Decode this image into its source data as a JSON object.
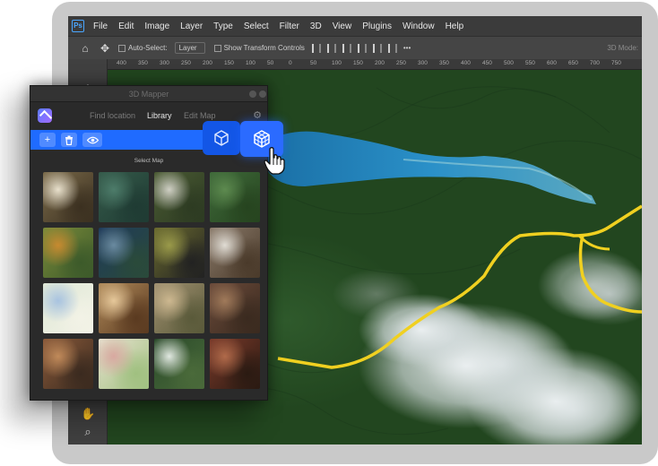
{
  "app": {
    "logo_text": "Ps",
    "menu": [
      "File",
      "Edit",
      "Image",
      "Layer",
      "Type",
      "Select",
      "Filter",
      "3D",
      "View",
      "Plugins",
      "Window",
      "Help"
    ]
  },
  "options_bar": {
    "auto_select_label": "Auto-Select:",
    "layer_select_value": "Layer",
    "show_transform_label": "Show Transform Controls",
    "mode_3d_label": "3D Mode:"
  },
  "ruler": {
    "ticks": [
      "400",
      "350",
      "300",
      "250",
      "200",
      "150",
      "100",
      "50",
      "0",
      "50",
      "100",
      "150",
      "200",
      "250",
      "300",
      "350",
      "400",
      "450",
      "500",
      "550",
      "600",
      "650",
      "700",
      "750"
    ]
  },
  "panel": {
    "title": "3D Mapper",
    "nav": [
      {
        "label": "Find location",
        "active": false
      },
      {
        "label": "Library",
        "active": true
      },
      {
        "label": "Edit Map",
        "active": false
      }
    ],
    "actions": [
      {
        "icon": "plus-icon",
        "glyph": "+"
      },
      {
        "icon": "trash-icon",
        "glyph": "🗑"
      },
      {
        "icon": "eye-icon",
        "glyph": "👁"
      }
    ],
    "select_map_label": "Select Map",
    "accent_color": "#1f6bff"
  },
  "thumbnails": [
    {
      "name": "map-thumb-mountain-relief",
      "colors": [
        "#7a6a4a",
        "#e8e0cc",
        "#3b3020"
      ]
    },
    {
      "name": "map-thumb-coastal-satellite",
      "colors": [
        "#355a4a",
        "#4d7c6a",
        "#1f3b33"
      ]
    },
    {
      "name": "map-thumb-alpine-snow",
      "colors": [
        "#4a5a33",
        "#cfcfc4",
        "#2d3b22"
      ]
    },
    {
      "name": "map-thumb-green-valley",
      "colors": [
        "#3f6a3a",
        "#5d8a4f",
        "#26441f"
      ]
    },
    {
      "name": "map-thumb-autumn-terrain",
      "colors": [
        "#7a8a3a",
        "#c78a30",
        "#3c5a2a"
      ]
    },
    {
      "name": "map-thumb-blue-coast",
      "colors": [
        "#1f3b5a",
        "#6a8aa0",
        "#2a4a3a"
      ]
    },
    {
      "name": "map-thumb-olive-lakes",
      "colors": [
        "#6a6a2f",
        "#9a9a4a",
        "#222"
      ]
    },
    {
      "name": "map-thumb-rocky-peaks",
      "colors": [
        "#8a7a6a",
        "#e0dcd4",
        "#4a3a2a"
      ]
    },
    {
      "name": "map-thumb-street-map",
      "colors": [
        "#dfe8d6",
        "#a8c3e0",
        "#f2f2e6"
      ]
    },
    {
      "name": "map-thumb-desert-canyon",
      "colors": [
        "#b08a5a",
        "#e6c89a",
        "#5a3a20"
      ]
    },
    {
      "name": "map-thumb-arid-fields",
      "colors": [
        "#a09070",
        "#cdb890",
        "#5a5a3a"
      ]
    },
    {
      "name": "map-thumb-brown-hills",
      "colors": [
        "#6a4a3a",
        "#a07a5a",
        "#3a2a1f"
      ]
    },
    {
      "name": "map-thumb-red-canyon",
      "colors": [
        "#8a5a3a",
        "#c08a5a",
        "#3a2a1f"
      ]
    },
    {
      "name": "map-thumb-topographic",
      "colors": [
        "#e8e2d0",
        "#d8a8a0",
        "#a0c080"
      ]
    },
    {
      "name": "map-thumb-forest-river",
      "colors": [
        "#2a4a2a",
        "#e0e8e0",
        "#4a6a3a"
      ]
    },
    {
      "name": "map-thumb-red-rocks",
      "colors": [
        "#7a3a2a",
        "#b06a4a",
        "#2a1a12"
      ]
    }
  ],
  "floating_buttons": [
    {
      "name": "cube-outline-button",
      "icon": "cube-icon"
    },
    {
      "name": "cube-grid-button",
      "icon": "cube-grid-icon"
    }
  ],
  "colors": {
    "route": "#f0d020",
    "lake": "#1f7fb5"
  }
}
